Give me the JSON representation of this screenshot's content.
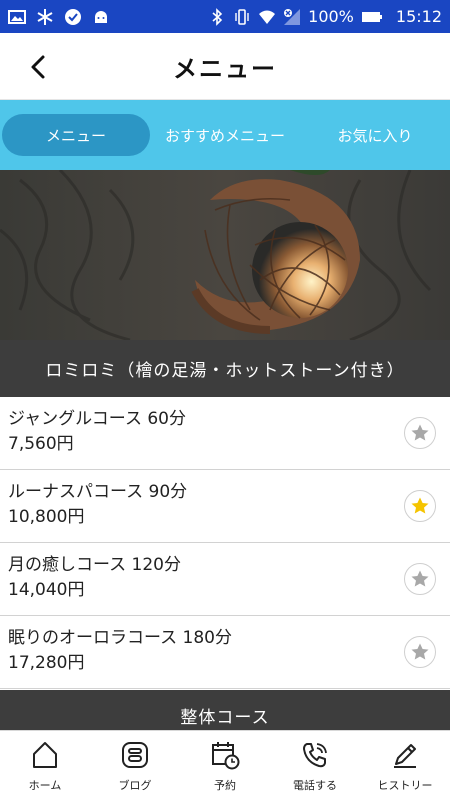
{
  "status_bar": {
    "battery": "100%",
    "time": "15:12"
  },
  "header": {
    "title": "メニュー",
    "back_icon": "chevron-left-icon"
  },
  "tabs": [
    {
      "label": "メニュー",
      "active": true
    },
    {
      "label": "おすすめメニュー",
      "active": false
    },
    {
      "label": "お気に入り",
      "active": false
    }
  ],
  "category": {
    "title": "ロミロミ（檜の足湯・ホットストーン付き）"
  },
  "courses": [
    {
      "name": "ジャングルコース 60分",
      "price": "7,560円",
      "favorite": false
    },
    {
      "name": "ルーナスパコース 90分",
      "price": "10,800円",
      "favorite": true
    },
    {
      "name": "月の癒しコース 120分",
      "price": "14,040円",
      "favorite": false
    },
    {
      "name": "眠りのオーロラコース 180分",
      "price": "17,280円",
      "favorite": false
    }
  ],
  "next_category": {
    "title": "整体コース"
  },
  "bottom_nav": [
    {
      "label": "ホーム",
      "icon": "home-icon"
    },
    {
      "label": "ブログ",
      "icon": "blog-icon"
    },
    {
      "label": "予約",
      "icon": "calendar-clock-icon"
    },
    {
      "label": "電話する",
      "icon": "phone-icon"
    },
    {
      "label": "ヒストリー",
      "icon": "pencil-icon"
    }
  ],
  "colors": {
    "status_bar": "#1a46c2",
    "tab_bar": "#4fc6ea",
    "tab_active": "#2c96c5",
    "category_bg": "#3d3d3d",
    "star_active": "#f5c400",
    "star_inactive": "#a8a8a8"
  }
}
